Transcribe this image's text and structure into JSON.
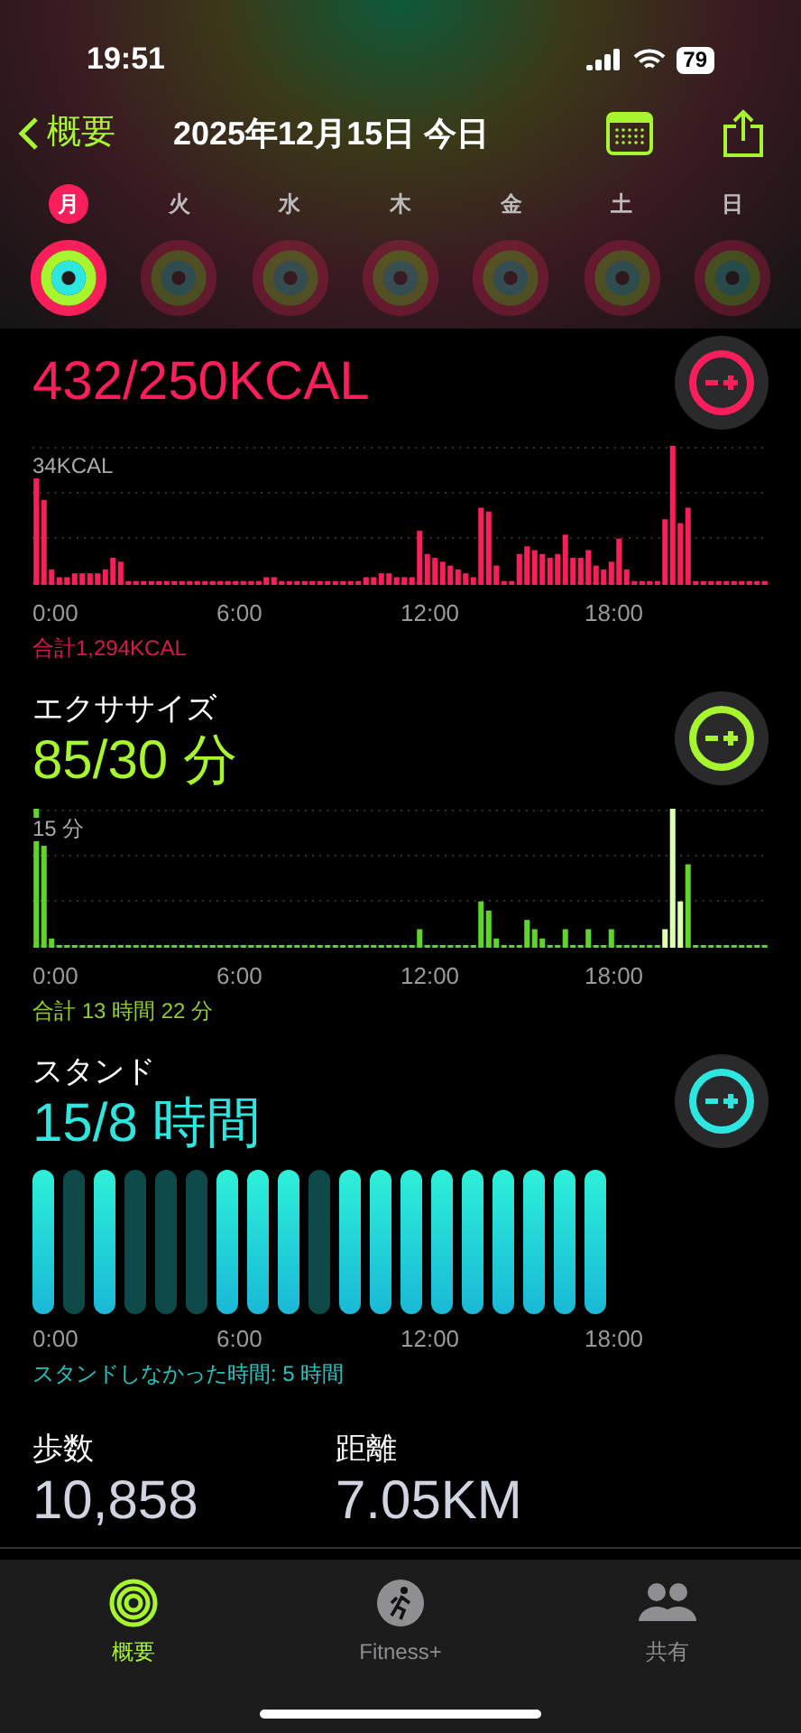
{
  "status_bar": {
    "time": "19:51",
    "battery": "79"
  },
  "nav": {
    "back": "概要",
    "title": "2025年12月15日 今日"
  },
  "days": [
    {
      "label": "月",
      "selected": true,
      "rings_closed": true
    },
    {
      "label": "火",
      "selected": false,
      "rings_closed": false
    },
    {
      "label": "水",
      "selected": false,
      "rings_closed": false
    },
    {
      "label": "木",
      "selected": false,
      "rings_closed": false
    },
    {
      "label": "金",
      "selected": false,
      "rings_closed": false
    },
    {
      "label": "土",
      "selected": false,
      "rings_closed": false
    },
    {
      "label": "日",
      "selected": false,
      "rings_closed": false
    }
  ],
  "sections": [
    {
      "kind": "move",
      "value": "432/250KCAL",
      "max_label": "34KCAL",
      "xticks": [
        "0:00",
        "6:00",
        "12:00",
        "18:00"
      ],
      "total": "合計1,294KCAL"
    },
    {
      "kind": "exercise",
      "title": "エクササイズ",
      "value": "85/30 分",
      "max_label": "15 分",
      "xticks": [
        "0:00",
        "6:00",
        "12:00",
        "18:00"
      ],
      "total": "合計 13 時間 22 分"
    },
    {
      "kind": "stand",
      "title": "スタンド",
      "value": "15/8 時間",
      "xticks": [
        "0:00",
        "6:00",
        "12:00",
        "18:00"
      ],
      "total": "スタンドしなかった時間: 5 時間",
      "hours": [
        {
          "stood": true
        },
        {
          "stood": false
        },
        {
          "stood": true
        },
        {
          "stood": false
        },
        {
          "stood": false
        },
        {
          "stood": false
        },
        {
          "stood": true
        },
        {
          "stood": true
        },
        {
          "stood": true
        },
        {
          "stood": false
        },
        {
          "stood": true
        },
        {
          "stood": true
        },
        {
          "stood": true
        },
        {
          "stood": true
        },
        {
          "stood": true
        },
        {
          "stood": true
        },
        {
          "stood": true
        },
        {
          "stood": true
        },
        {
          "stood": true
        }
      ]
    }
  ],
  "stats": [
    {
      "label": "歩数",
      "value": "10,858"
    },
    {
      "label": "距離",
      "value": "7.05KM"
    }
  ],
  "tabs": [
    {
      "label": "概要",
      "selected": true,
      "kind": "summary"
    },
    {
      "label": "Fitness+",
      "selected": false,
      "kind": "fitness"
    },
    {
      "label": "共有",
      "selected": false,
      "kind": "sharing"
    }
  ]
}
